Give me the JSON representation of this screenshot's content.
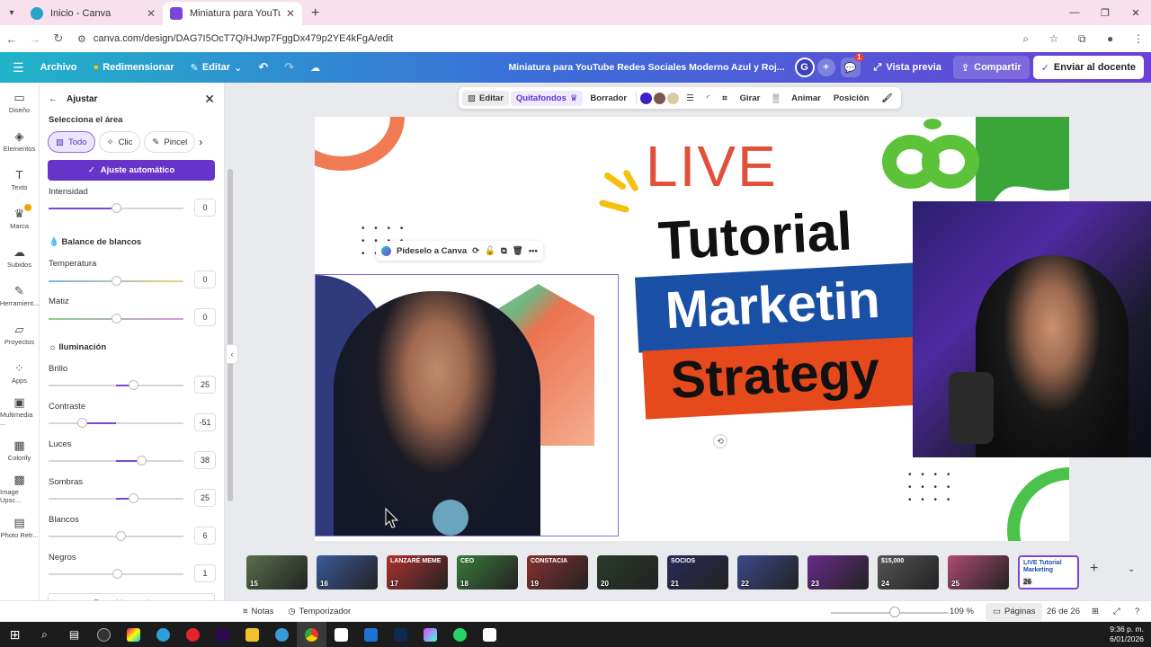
{
  "browser": {
    "tabs": [
      {
        "title": "Inicio - Canva",
        "active": false
      },
      {
        "title": "Miniatura para YouTube Redes",
        "active": true
      }
    ],
    "url": "canva.com/design/DAG7I5OcT7Q/HJwp7FggDx479p2YE4kFgA/edit"
  },
  "topbar": {
    "menu": "Archivo",
    "resize": "Redimensionar",
    "edit": "Editar",
    "doc_title": "Miniatura para YouTube Redes Sociales  Moderno Azul y Roj...",
    "avatar_letter": "G",
    "notif_count": "1",
    "preview": "Vista previa",
    "share": "Compartir",
    "send": "Enviar al docente"
  },
  "rail": [
    {
      "label": "Diseño",
      "icon": "layout-icon"
    },
    {
      "label": "Elementos",
      "icon": "shapes-icon"
    },
    {
      "label": "Texto",
      "icon": "text-icon"
    },
    {
      "label": "Marca",
      "icon": "brand-icon"
    },
    {
      "label": "Subidos",
      "icon": "upload-icon"
    },
    {
      "label": "Herramient...",
      "icon": "tools-icon"
    },
    {
      "label": "Proyectos",
      "icon": "folder-icon"
    },
    {
      "label": "Apps",
      "icon": "apps-icon"
    },
    {
      "label": "Multimedia ...",
      "icon": "media-icon"
    },
    {
      "label": "Colorify",
      "icon": "colorify-icon"
    },
    {
      "label": "Image Upsc...",
      "icon": "upscale-icon"
    },
    {
      "label": "Photo Retr...",
      "icon": "retro-icon"
    }
  ],
  "panel": {
    "title": "Ajustar",
    "select_area": "Selecciona el área",
    "modes": [
      "Todo",
      "Clic",
      "Pincel"
    ],
    "auto": "Ajuste automático",
    "intensity": {
      "label": "Intensidad",
      "value": "0",
      "level": 0.5
    },
    "white_balance": "Balance de blancos",
    "temperature": {
      "label": "Temperatura",
      "value": "0"
    },
    "tint": {
      "label": "Matiz",
      "value": "0"
    },
    "lighting": "Iluminación",
    "sliders": [
      {
        "label": "Brillo",
        "value": "25",
        "pos": 0.625
      },
      {
        "label": "Contraste",
        "value": "-51",
        "pos": 0.245
      },
      {
        "label": "Luces",
        "value": "38",
        "pos": 0.69
      },
      {
        "label": "Sombras",
        "value": "25",
        "pos": 0.625
      },
      {
        "label": "Blancos",
        "value": "6",
        "pos": 0.53
      },
      {
        "label": "Negros",
        "value": "1",
        "pos": 0.505
      }
    ],
    "reset": "Restablecer ajustes"
  },
  "context_toolbar": {
    "edit": "Editar",
    "bg_remover": "Quitafondos",
    "eraser": "Borrador",
    "colors": [
      "#3b1fc7",
      "#7a5850",
      "#d8cca4"
    ],
    "rotate": "Girar",
    "animate": "Animar",
    "position": "Posición"
  },
  "canvas": {
    "live": "LIVE",
    "tutorial": "Tutorial",
    "marketing": "Marketin",
    "strategy": "Strategy",
    "ask_canva": "Pídeselo a Canva"
  },
  "pages": {
    "thumbnails": [
      "15",
      "16",
      "17",
      "18",
      "19",
      "20",
      "21",
      "22",
      "23",
      "24",
      "25",
      "26"
    ],
    "thumb_text": [
      "",
      "",
      "LANZARÉ MEME",
      "CEO",
      "CONSTACIA",
      "",
      "SOCIOS",
      "",
      "",
      "$15,000",
      "",
      "LIVE Tutorial Marketing"
    ],
    "active": "26"
  },
  "bottombar": {
    "notes": "Notas",
    "timer": "Temporizador",
    "zoom": "109 %",
    "pages": "Páginas",
    "page_count": "26 de 26"
  },
  "taskbar": {
    "time": "9:36 p. m.",
    "date": "6/01/2026"
  },
  "colors": {
    "accent": "#7d44d9",
    "topbar_start": "#21b3c9",
    "topbar_end": "#6d3fd6"
  }
}
